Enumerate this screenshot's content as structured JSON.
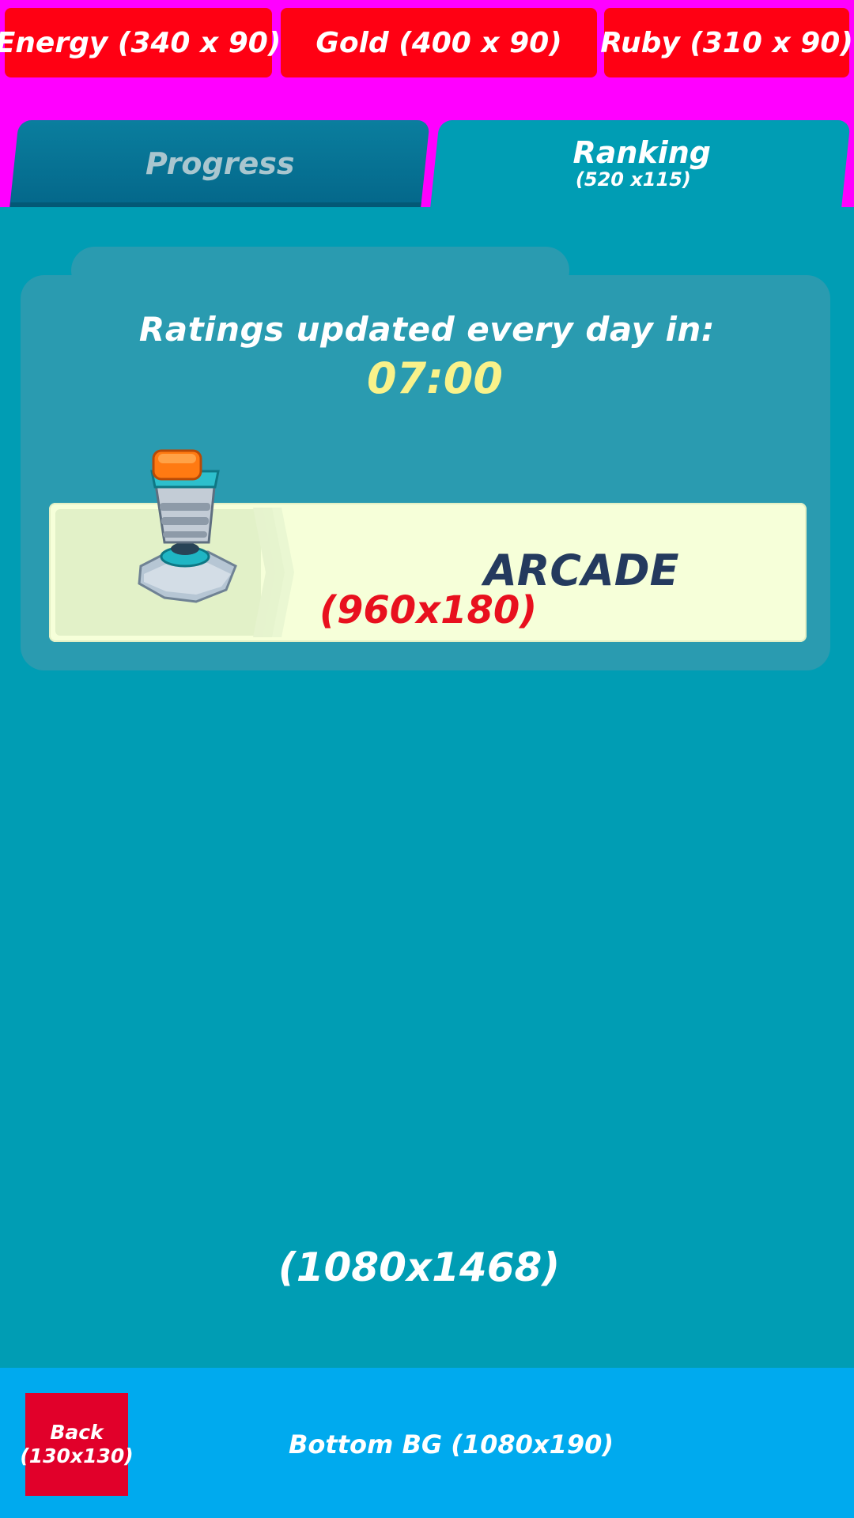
{
  "resources": {
    "energy_label": "Energy (340 x 90)",
    "gold_label": "Gold (400 x 90)",
    "ruby_label": "Ruby (310 x 90)"
  },
  "tabs": {
    "progress_label": "Progress",
    "ranking_label": "Ranking",
    "ranking_size": "(520 x115)"
  },
  "main": {
    "ratings_text": "Ratings updated every day in:",
    "update_time": "07:00",
    "card_label": "ARCADE",
    "card_size": "(960x180)",
    "panel_size": "(1080x1468)",
    "card_icon": "joystick-icon"
  },
  "bottom": {
    "back_label": "Back\n(130x130)",
    "bg_label": "Bottom BG (1080x190)"
  },
  "colors": {
    "magenta_bg": "#ff00ff",
    "resource_red": "#ff0013",
    "panel_teal": "#009db4",
    "progress_tab": "#04678a",
    "time_yellow": "#f9f28a",
    "card_bg": "#f6ffd9",
    "arcade_text": "#243a5e",
    "size_red": "#e8101e",
    "bottom_blue": "#00aaee",
    "back_red": "#e1002a"
  }
}
